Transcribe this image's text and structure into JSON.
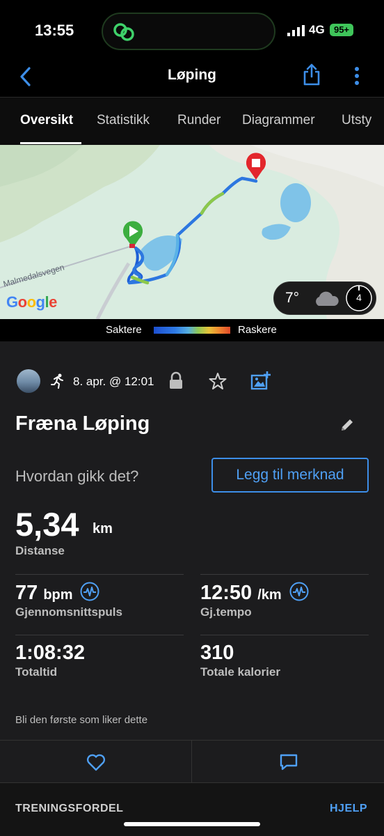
{
  "status": {
    "time": "13:55",
    "network": "4G",
    "battery": "95+"
  },
  "nav": {
    "title": "Løping"
  },
  "tabs": [
    "Oversikt",
    "Statistikk",
    "Runder",
    "Diagrammer",
    "Utsty"
  ],
  "map": {
    "road_label": "Malmedalsvegen",
    "provider": "Google",
    "weather": {
      "temperature": "7°",
      "wind": "4"
    }
  },
  "legend": {
    "slow": "Saktere",
    "fast": "Raskere"
  },
  "activity": {
    "date": "8. apr. @ 12:01",
    "title": "Fræna Løping",
    "feedback_prompt": "Hvordan gikk det?",
    "add_note": "Legg til merknad"
  },
  "stats": {
    "distance": {
      "value": "5,34",
      "unit": "km",
      "label": "Distanse"
    },
    "heart_rate": {
      "value": "77",
      "unit": "bpm",
      "label": "Gjennomsnittspuls"
    },
    "pace": {
      "value": "12:50",
      "unit": "/km",
      "label": "Gj.tempo"
    },
    "total_time": {
      "value": "1:08:32",
      "label": "Totaltid"
    },
    "calories": {
      "value": "310",
      "label": "Totale kalorier"
    }
  },
  "social": {
    "like_prompt": "Bli den første som liker dette"
  },
  "footer": {
    "section": "TRENINGSFORDEL",
    "help": "HJELP"
  },
  "colors": {
    "accent": "#4fa0f5",
    "start": "#3cae3f",
    "finish": "#e3262c"
  }
}
